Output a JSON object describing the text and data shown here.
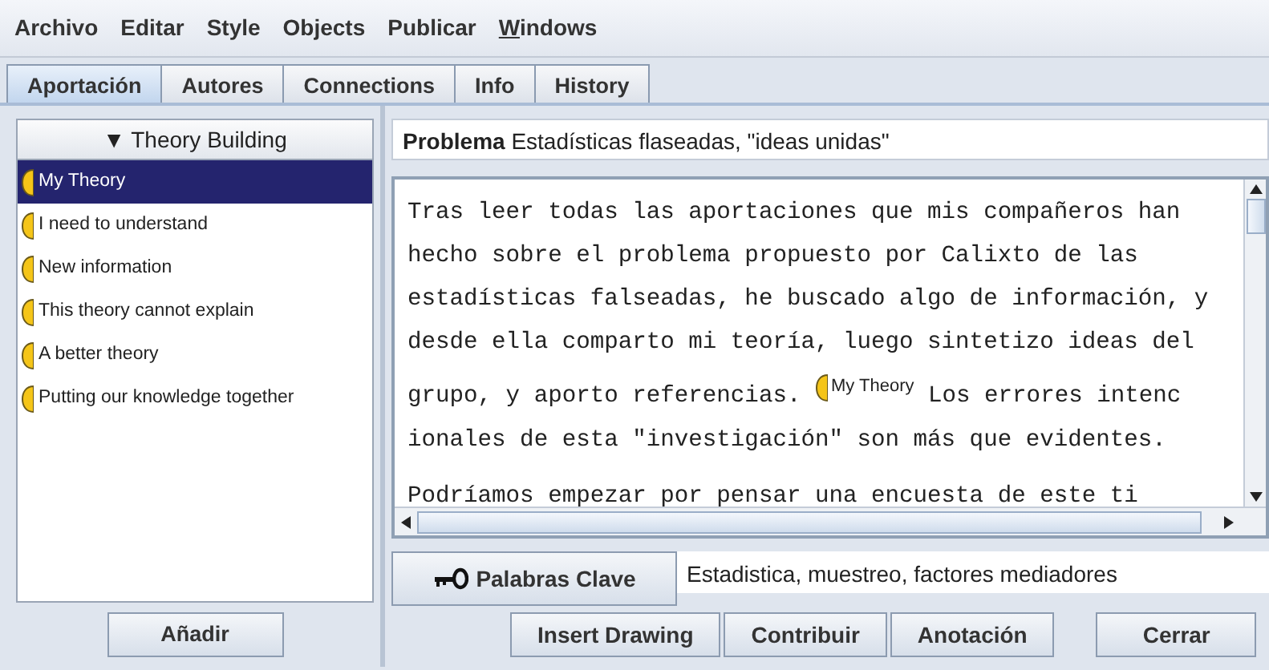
{
  "menu": [
    {
      "label": "Archivo",
      "mnemonic": false
    },
    {
      "label": "Editar",
      "mnemonic": false
    },
    {
      "label": "Style",
      "mnemonic": false
    },
    {
      "label": "Objects",
      "mnemonic": false
    },
    {
      "label": "Publicar",
      "mnemonic": false
    },
    {
      "label": "Windows",
      "mnemonic": true
    }
  ],
  "tabs": [
    {
      "label": "Aportación",
      "selected": true
    },
    {
      "label": "Autores",
      "selected": false
    },
    {
      "label": "Connections",
      "selected": false
    },
    {
      "label": "Info",
      "selected": false
    },
    {
      "label": "History",
      "selected": false
    }
  ],
  "sidebar": {
    "header": "▼ Theory Building",
    "items": [
      {
        "label": "My Theory",
        "selected": true
      },
      {
        "label": "I need to understand",
        "selected": false
      },
      {
        "label": "New information",
        "selected": false
      },
      {
        "label": "This theory cannot explain",
        "selected": false
      },
      {
        "label": "A better theory",
        "selected": false
      },
      {
        "label": "Putting our knowledge together",
        "selected": false
      }
    ],
    "add_button": "Añadir"
  },
  "note": {
    "type_label": "Problema",
    "title": "Estadísticas flaseadas, \"ideas unidas\"",
    "paragraphs": [
      {
        "lines": [
          [
            {
              "kind": "text",
              "text": "Tras leer todas las aportaciones que mis compañeros han"
            }
          ],
          [
            {
              "kind": "text",
              "text": "hecho sobre el problema propuesto por Calixto de las"
            }
          ],
          [
            {
              "kind": "text",
              "text": "estadísticas falseadas, he buscado algo de información, y"
            }
          ],
          [
            {
              "kind": "text",
              "text": "desde ella comparto mi teoría, luego sintetizo ideas del"
            }
          ],
          [
            {
              "kind": "text",
              "text": "grupo, y aporto referencias. "
            },
            {
              "kind": "scaffold",
              "text": "My Theory"
            },
            {
              "kind": "text",
              "text": " Los errores intenc"
            }
          ],
          [
            {
              "kind": "text",
              "text": "ionales de esta \"investigación\" son más que evidentes."
            }
          ]
        ]
      },
      {
        "lines": [
          [
            {
              "kind": "text",
              "text": "Podríamos empezar por pensar una encuesta de este ti"
            }
          ]
        ]
      }
    ]
  },
  "keywords": {
    "button": "Palabras Clave",
    "value": "Estadistica, muestreo, factores mediadores"
  },
  "buttons": [
    "Insert Drawing",
    "Contribuir",
    "Anotación",
    "Cerrar"
  ]
}
